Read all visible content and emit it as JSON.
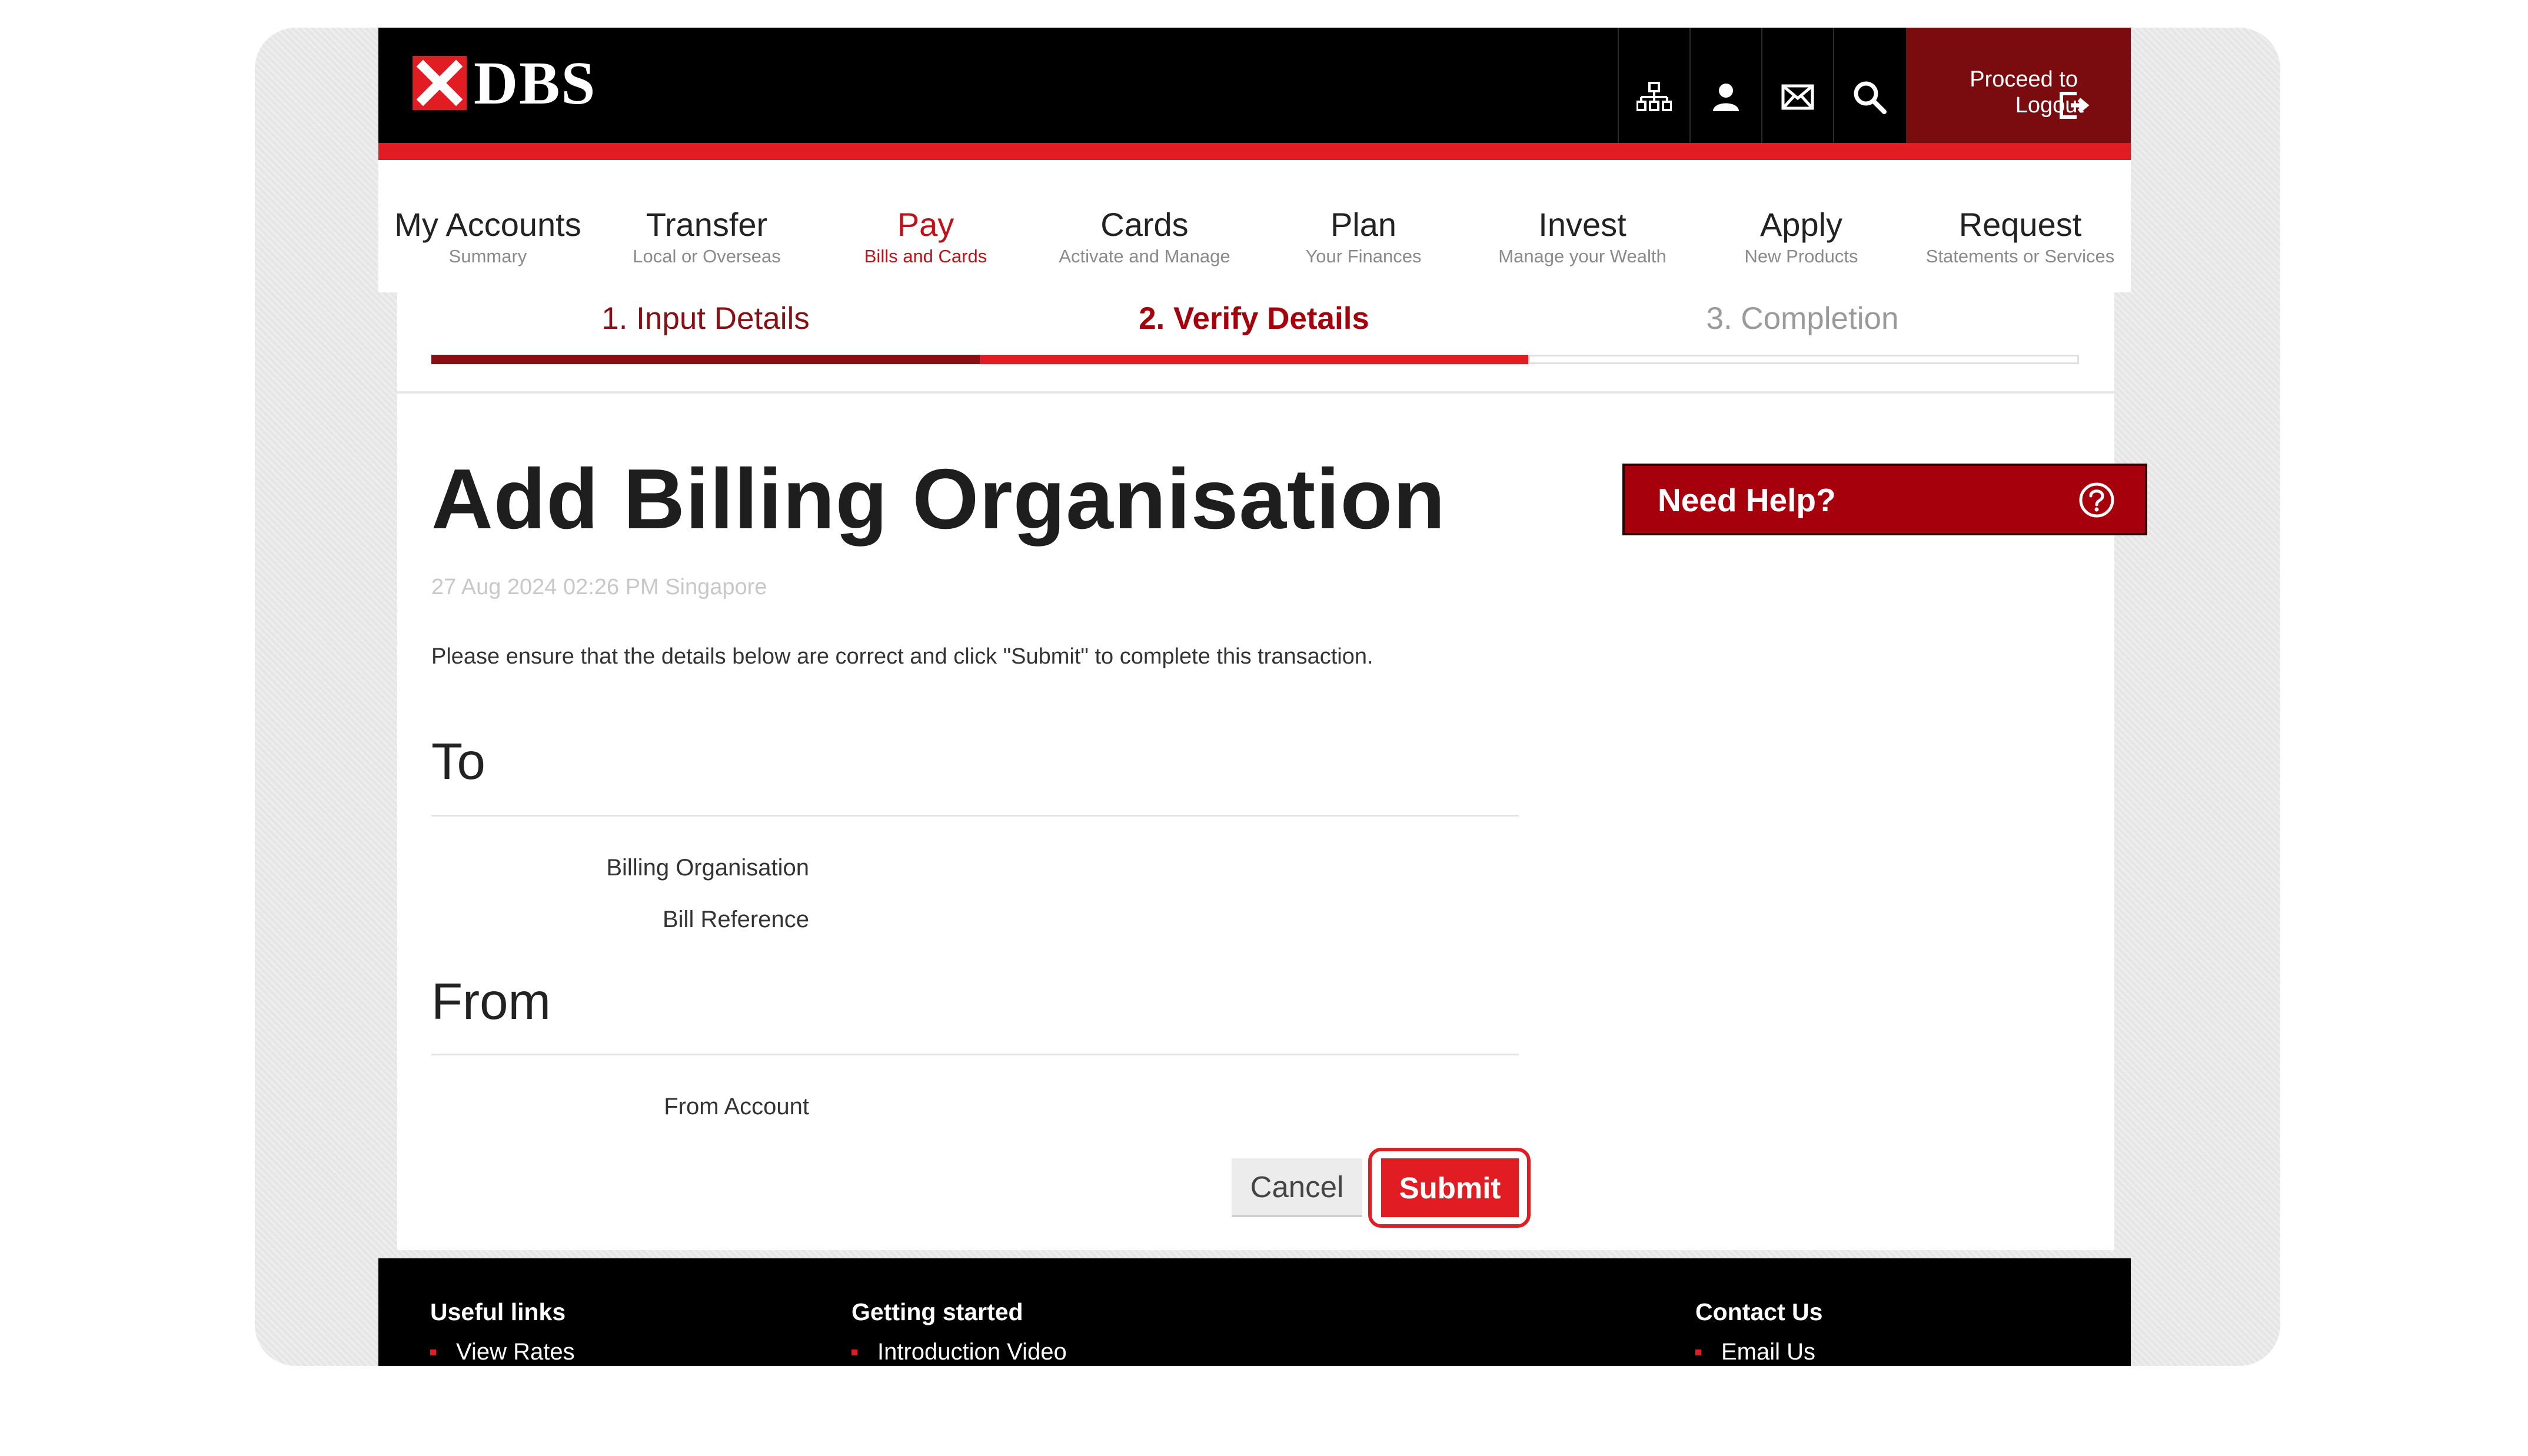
{
  "header": {
    "logo_text": "DBS",
    "logout_line1": "Proceed to",
    "logout_line2": "Logout",
    "tools": [
      "sitemap-icon",
      "user-icon",
      "mail-icon",
      "search-icon"
    ]
  },
  "nav": {
    "items": [
      {
        "title": "My Accounts",
        "sub": "Summary"
      },
      {
        "title": "Transfer",
        "sub": "Local or Overseas"
      },
      {
        "title": "Pay",
        "sub": "Bills and Cards"
      },
      {
        "title": "Cards",
        "sub": "Activate and Manage"
      },
      {
        "title": "Plan",
        "sub": "Your Finances"
      },
      {
        "title": "Invest",
        "sub": "Manage your Wealth"
      },
      {
        "title": "Apply",
        "sub": "New Products"
      },
      {
        "title": "Request",
        "sub": "Statements or Services"
      }
    ],
    "active": "Pay"
  },
  "steps": [
    {
      "label": "1. Input Details",
      "state": "done"
    },
    {
      "label": "2. Verify Details",
      "state": "current"
    },
    {
      "label": "3. Completion",
      "state": "pending"
    }
  ],
  "page": {
    "title": "Add Billing Organisation",
    "timestamp": "27 Aug 2024 02:26 PM Singapore",
    "instruction": "Please ensure that the details below are correct and click \"Submit\" to complete this transaction."
  },
  "to_section": {
    "heading": "To",
    "fields": [
      "Billing Organisation",
      "Bill Reference"
    ]
  },
  "from_section": {
    "heading": "From",
    "fields": [
      "From Account"
    ]
  },
  "actions": {
    "cancel": "Cancel",
    "submit": "Submit"
  },
  "help": {
    "label": "Need Help?"
  },
  "footer": {
    "useful_links": {
      "heading": "Useful links",
      "link": "View Rates"
    },
    "getting_started": {
      "heading": "Getting started",
      "link": "Introduction Video"
    },
    "contact_us": {
      "heading": "Contact Us",
      "link": "Email Us"
    }
  },
  "colors": {
    "brand_red": "#e21c23",
    "dark_red": "#a5000c",
    "step_done": "#8a0f14",
    "header_black": "#000000"
  }
}
